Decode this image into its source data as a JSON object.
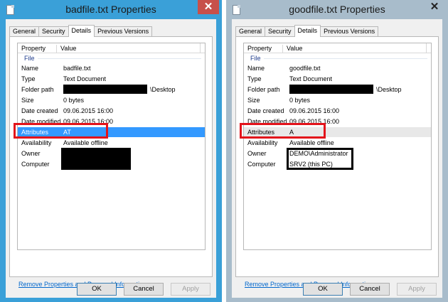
{
  "left": {
    "title": "badfile.txt Properties",
    "close_glyph": "✕",
    "tabs": [
      "General",
      "Security",
      "Details",
      "Previous Versions"
    ],
    "header": {
      "property": "Property",
      "value": "Value"
    },
    "group": "File",
    "rows": [
      {
        "k": "Name",
        "v": "badfile.txt"
      },
      {
        "k": "Type",
        "v": "Text Document"
      },
      {
        "k": "Folder path",
        "v": "\\Desktop"
      },
      {
        "k": "Size",
        "v": "0 bytes"
      },
      {
        "k": "Date created",
        "v": "09.06.2015 16:00"
      },
      {
        "k": "Date modified",
        "v": "09.06.2015 16:00"
      },
      {
        "k": "Attributes",
        "v": "AT"
      },
      {
        "k": "Availability",
        "v": "Available offline"
      },
      {
        "k": "Owner",
        "v": ""
      },
      {
        "k": "Computer",
        "v": ""
      }
    ],
    "link": "Remove Properties and Personal Information",
    "ok": "OK",
    "cancel": "Cancel",
    "apply": "Apply"
  },
  "right": {
    "title": "goodfile.txt Properties",
    "close_glyph": "✕",
    "tabs": [
      "General",
      "Security",
      "Details",
      "Previous Versions"
    ],
    "header": {
      "property": "Property",
      "value": "Value"
    },
    "group": "File",
    "rows": [
      {
        "k": "Name",
        "v": "goodfile.txt"
      },
      {
        "k": "Type",
        "v": "Text Document"
      },
      {
        "k": "Folder path",
        "v": "\\Desktop"
      },
      {
        "k": "Size",
        "v": "0 bytes"
      },
      {
        "k": "Date created",
        "v": "09.06.2015 16:00"
      },
      {
        "k": "Date modified",
        "v": "09.06.2015 16:00"
      },
      {
        "k": "Attributes",
        "v": "A"
      },
      {
        "k": "Availability",
        "v": "Available offline"
      },
      {
        "k": "Owner",
        "v": "DEMO\\Administrator"
      },
      {
        "k": "Computer",
        "v": "SRV2 (this PC)"
      }
    ],
    "link": "Remove Properties and Personal Information",
    "ok": "OK",
    "cancel": "Cancel",
    "apply": "Apply"
  },
  "colors": {
    "left_titlebar": "#3aa0d8",
    "right_titlebar": "#a8bccb",
    "selection": "#3399ff",
    "highlight": "#e3131b"
  }
}
